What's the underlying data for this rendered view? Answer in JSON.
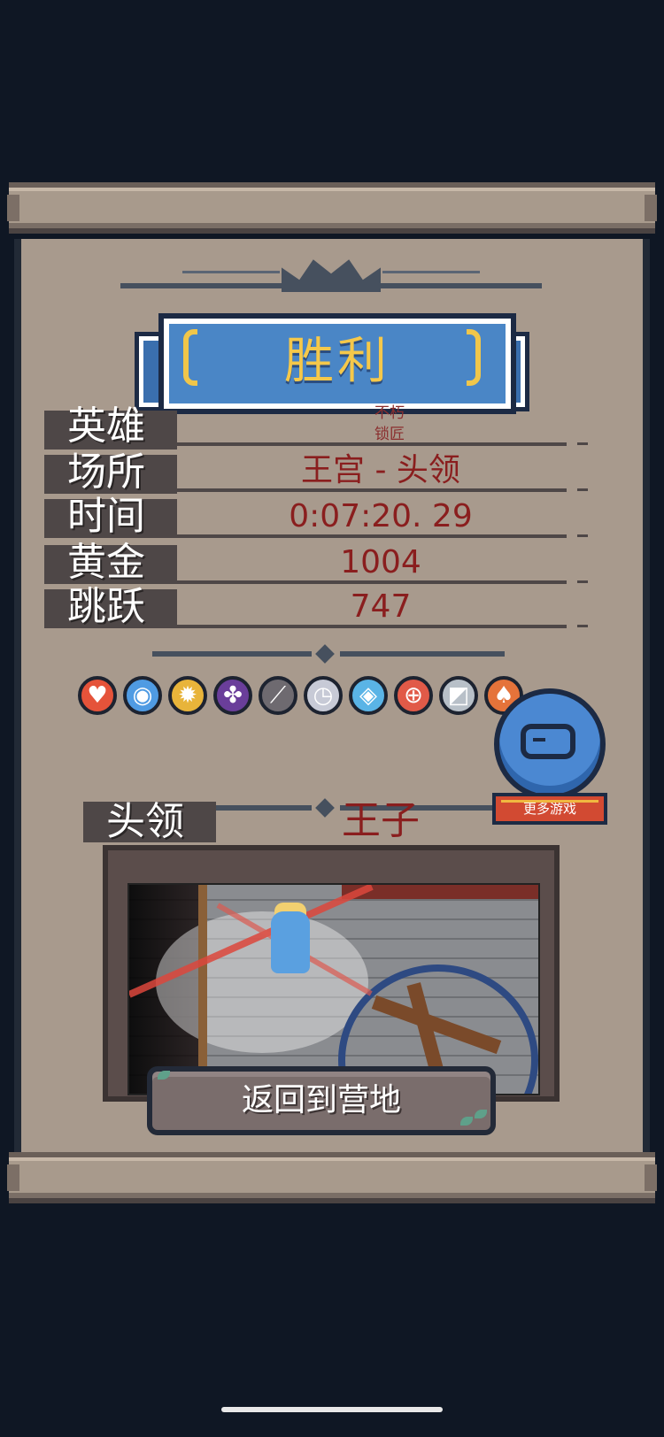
{
  "result": {
    "title": "胜利"
  },
  "stats": {
    "hero": {
      "label": "英雄",
      "value_line1": "不朽",
      "value_line2": "锁匠"
    },
    "location": {
      "label": "场所",
      "value": "王宫 - 头领"
    },
    "time": {
      "label": "时间",
      "value": "0:07:20. 29"
    },
    "gold": {
      "label": "黄金",
      "value": "1004"
    },
    "jumps": {
      "label": "跳跃",
      "value": "747"
    }
  },
  "items": [
    {
      "name": "heart-emblem-icon",
      "glyph": "♥",
      "color": "#e5533a"
    },
    {
      "name": "blue-ghost-icon",
      "glyph": "◉",
      "color": "#4f9be3"
    },
    {
      "name": "cross-blades-icon",
      "glyph": "✹",
      "color": "#e8b43a"
    },
    {
      "name": "berries-icon",
      "glyph": "✤",
      "color": "#6a3e9a"
    },
    {
      "name": "pickaxe-icon",
      "glyph": "⟋",
      "color": "#6e6a70"
    },
    {
      "name": "clock-icon",
      "glyph": "◷",
      "color": "#c7cad6"
    },
    {
      "name": "mirror-icon",
      "glyph": "◈",
      "color": "#5ab4e6"
    },
    {
      "name": "target-icon",
      "glyph": "⊕",
      "color": "#e15a48"
    },
    {
      "name": "glass-panel-icon",
      "glyph": "◩",
      "color": "#b8c0c8"
    },
    {
      "name": "mushroom-icon",
      "glyph": "♠",
      "color": "#e5733a"
    }
  ],
  "boss": {
    "label": "头领",
    "value": "王子"
  },
  "buttons": {
    "return_label": "返回到营地",
    "more_games_label": "更多游戏"
  }
}
